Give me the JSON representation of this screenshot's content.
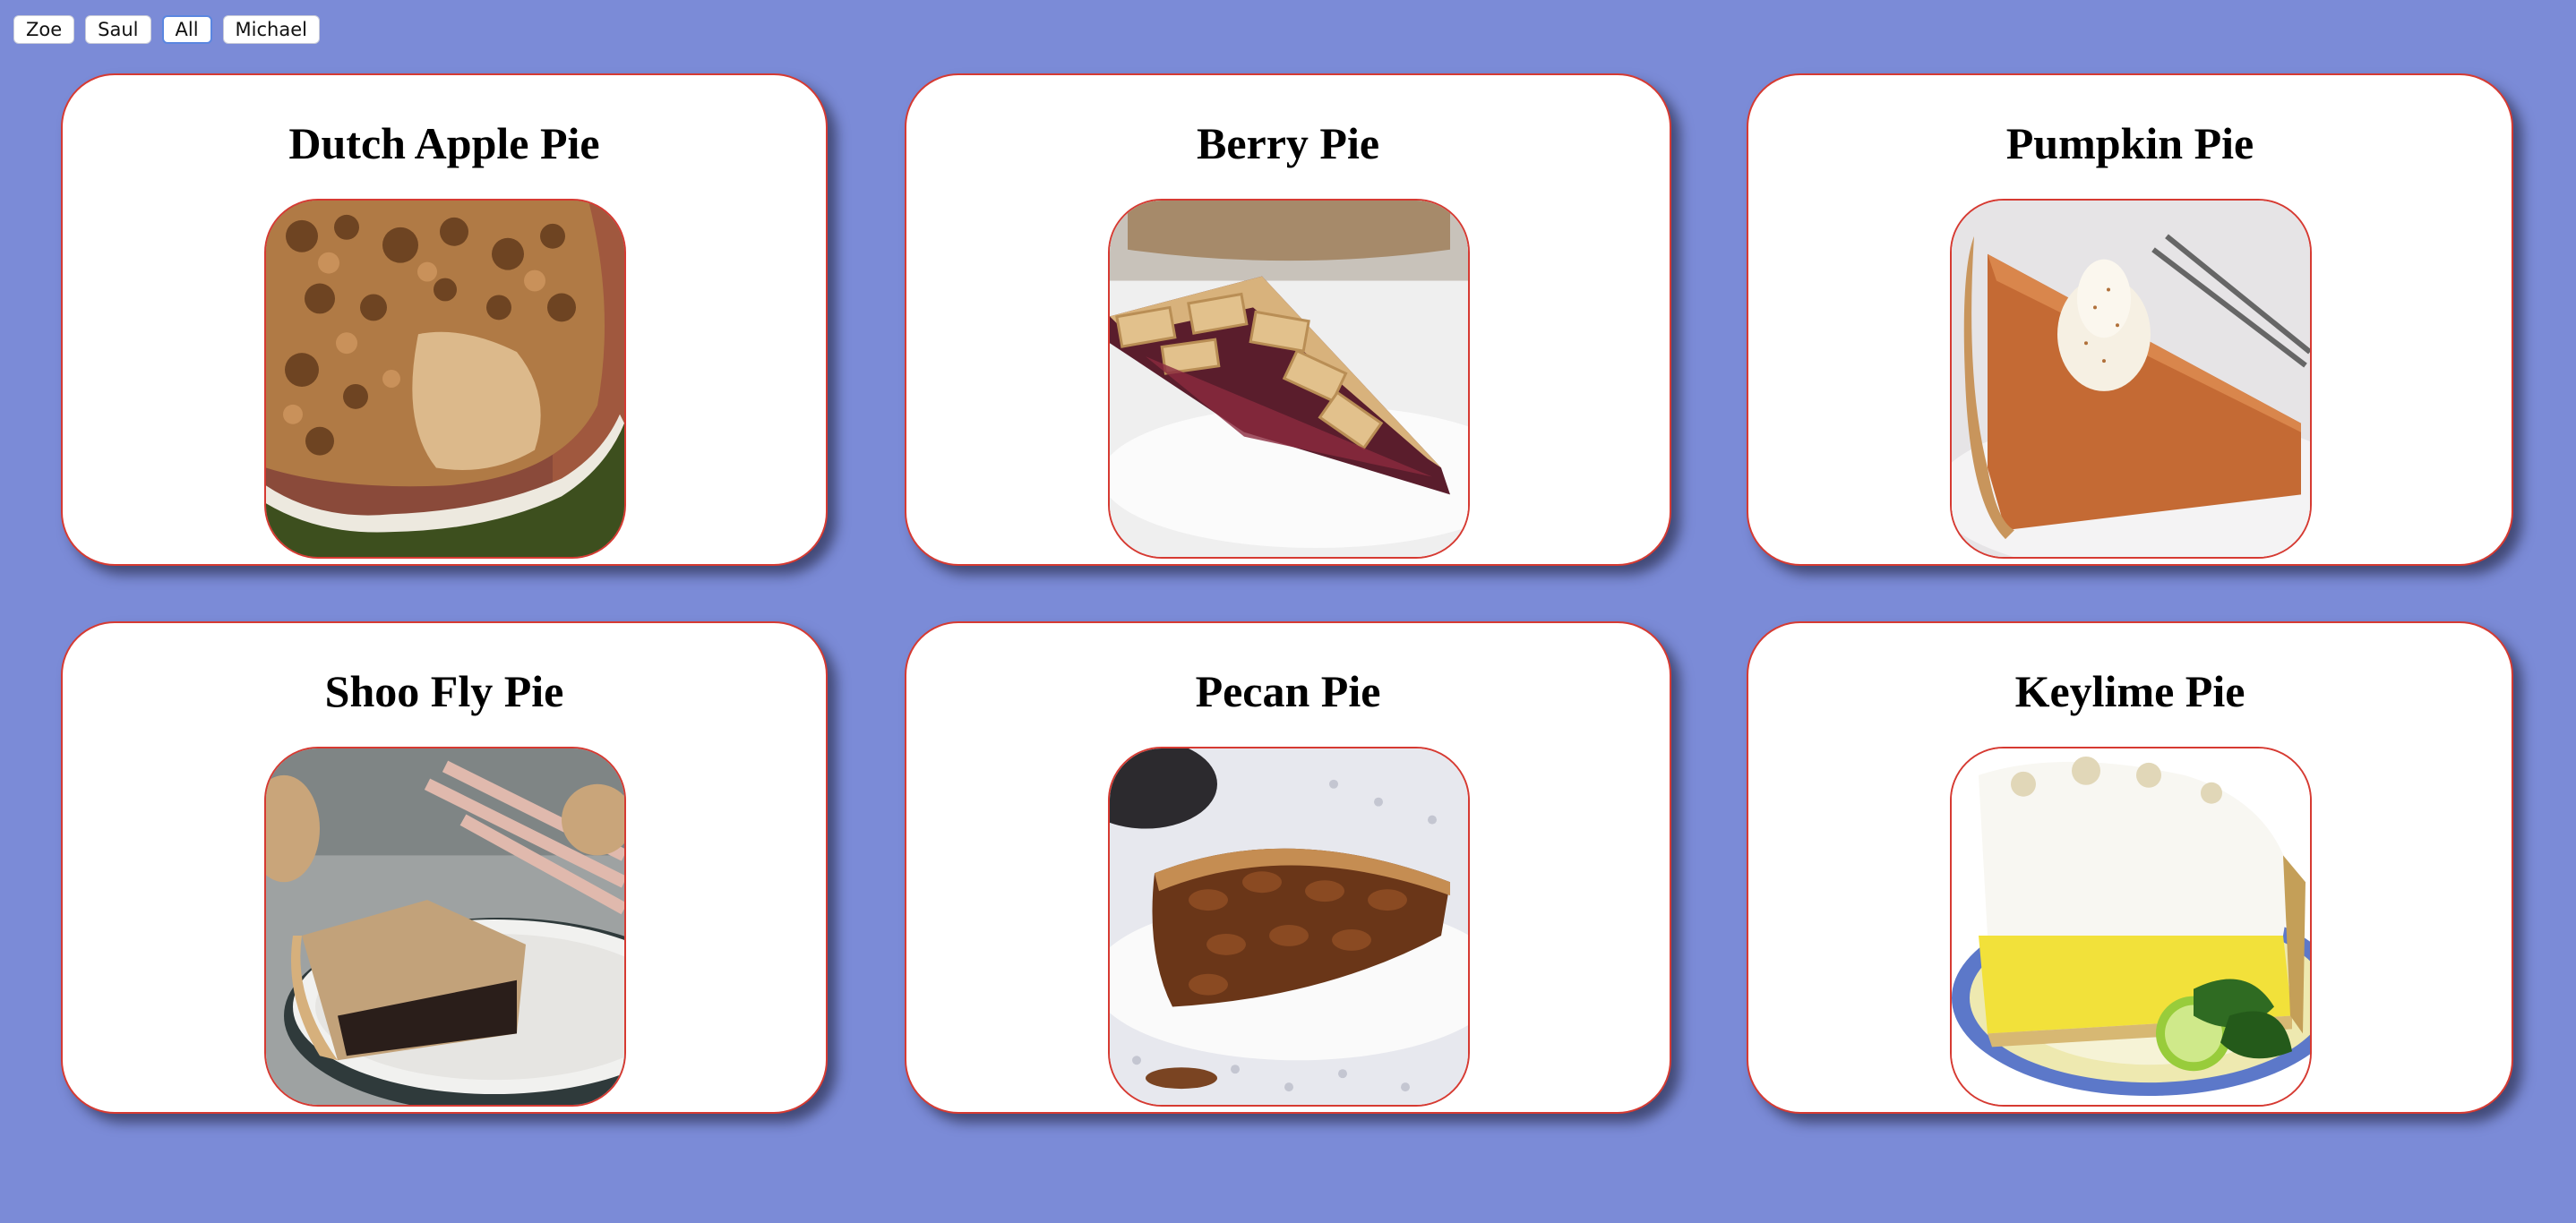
{
  "filters": [
    {
      "label": "Zoe",
      "active": false
    },
    {
      "label": "Saul",
      "active": false
    },
    {
      "label": "All",
      "active": true
    },
    {
      "label": "Michael",
      "active": false
    }
  ],
  "pies": [
    {
      "title": "Dutch Apple Pie",
      "image": "dutch-apple-pie-photo"
    },
    {
      "title": "Berry Pie",
      "image": "berry-pie-photo"
    },
    {
      "title": "Pumpkin Pie",
      "image": "pumpkin-pie-photo"
    },
    {
      "title": "Shoo Fly Pie",
      "image": "shoo-fly-pie-photo"
    },
    {
      "title": "Pecan Pie",
      "image": "pecan-pie-photo"
    },
    {
      "title": "Keylime Pie",
      "image": "keylime-pie-photo"
    }
  ],
  "colors": {
    "background": "#7b8bd7",
    "card_border": "#d63a32",
    "active_filter_border": "#5a86e0"
  }
}
